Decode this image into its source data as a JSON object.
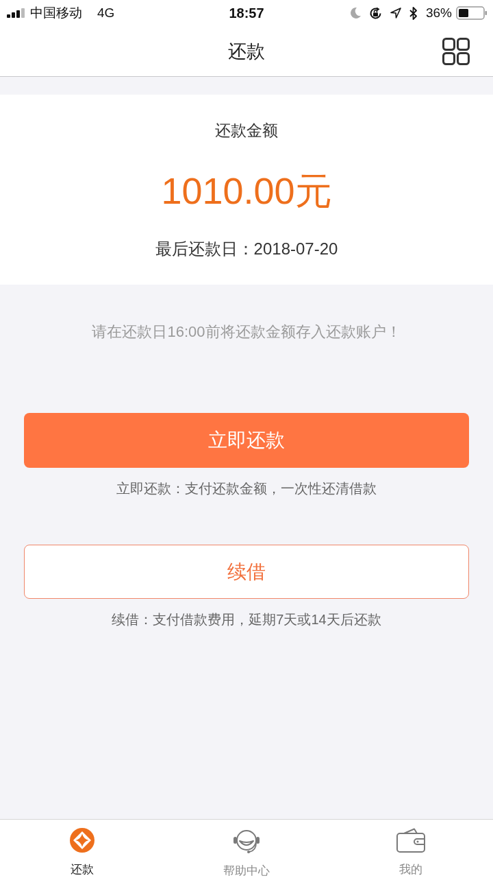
{
  "status_bar": {
    "carrier": "中国移动",
    "network": "4G",
    "time": "18:57",
    "battery": "36%"
  },
  "nav_bar": {
    "title": "还款"
  },
  "summary": {
    "label": "还款金额",
    "amount": "1010.00元",
    "due_label": "最后还款日：2018-07-20"
  },
  "notice": "请在还款日16:00前将还款金额存入还款账户！",
  "actions": [
    {
      "kind": "primary",
      "label": "立即还款",
      "caption": "立即还款：支付还款金额，一次性还清借款"
    },
    {
      "kind": "outline",
      "label": "续借",
      "caption": "续借：支付借款费用，延期7天或14天后还款"
    }
  ],
  "tab_bar": [
    {
      "label": "还款",
      "selected": true
    },
    {
      "label": "帮助中心",
      "selected": false
    },
    {
      "label": "我的",
      "selected": false
    }
  ]
}
